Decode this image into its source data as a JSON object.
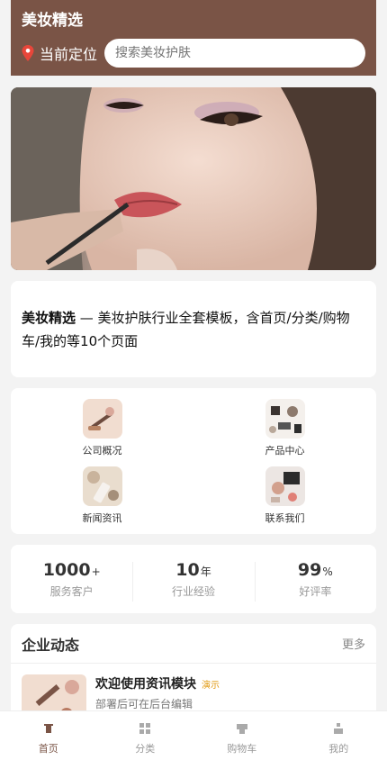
{
  "header": {
    "brand": "美妆精选",
    "location": "当前定位",
    "search_placeholder": "搜索美妆护肤"
  },
  "intro": {
    "bold": "美妆精选",
    "text": " — 美妆护肤行业全套模板，含首页/分类/购物车/我的等10个页面"
  },
  "menu": [
    {
      "label": "公司概况"
    },
    {
      "label": "产品中心"
    },
    {
      "label": "新闻资讯"
    },
    {
      "label": "联系我们"
    }
  ],
  "stats": [
    {
      "value": "1000",
      "unit": "+",
      "label": "服务客户"
    },
    {
      "value": "10",
      "unit": "年",
      "label": "行业经验"
    },
    {
      "value": "99",
      "unit": "%",
      "label": "好评率"
    }
  ],
  "news": {
    "title": "企业动态",
    "more": "更多",
    "items": [
      {
        "title": "欢迎使用资讯模块",
        "badge": "演示",
        "desc": "部署后可在后台编辑"
      }
    ]
  },
  "tabs": [
    {
      "label": "首页",
      "icon": "home-icon"
    },
    {
      "label": "分类",
      "icon": "grid-icon"
    },
    {
      "label": "购物车",
      "icon": "cart-icon"
    },
    {
      "label": "我的",
      "icon": "user-icon"
    }
  ],
  "colors": {
    "brand": "#7a5446",
    "badge": "#e19a12"
  }
}
